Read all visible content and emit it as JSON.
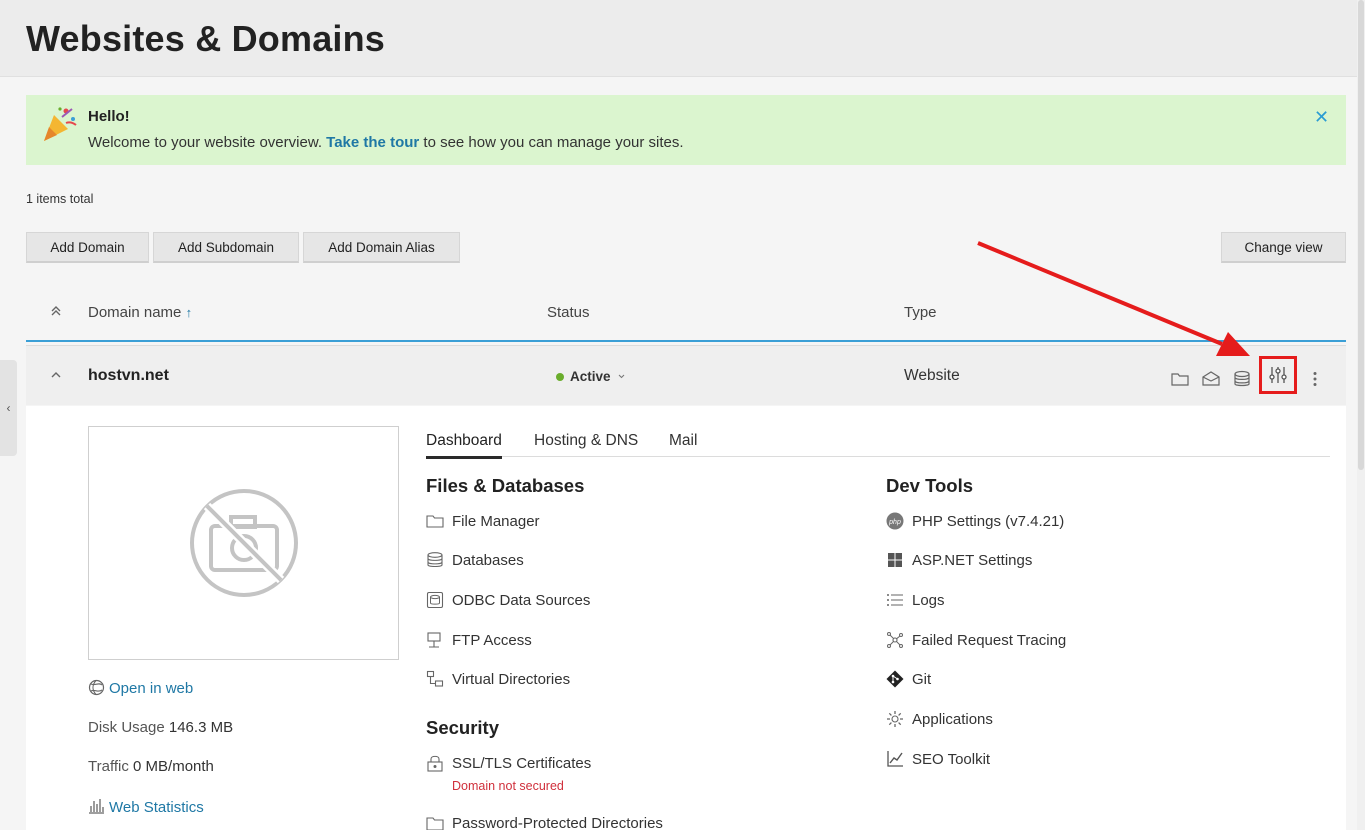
{
  "page": {
    "title": "Websites & Domains"
  },
  "banner": {
    "hello": "Hello!",
    "msg_before": "Welcome to your website overview. ",
    "tour_link": "Take the tour",
    "msg_after": " to see how you can manage your sites.",
    "close": "✕"
  },
  "list": {
    "total": "1 items total"
  },
  "toolbar": {
    "add_domain": "Add Domain",
    "add_subdomain": "Add Subdomain",
    "add_alias": "Add Domain Alias",
    "change_view": "Change view"
  },
  "table": {
    "col_domain": "Domain name",
    "sort_indicator": "↑",
    "col_status": "Status",
    "col_type": "Type"
  },
  "domain_row": {
    "name": "hostvn.net",
    "status": "Active",
    "type": "Website",
    "status_color": "#6aad2c"
  },
  "details": {
    "open_in_web": "Open in web",
    "disk_usage_label": "Disk Usage",
    "disk_usage_value": "146.3 MB",
    "traffic_label": "Traffic",
    "traffic_value": "0 MB/month",
    "web_statistics": "Web Statistics",
    "tabs": [
      "Dashboard",
      "Hosting & DNS",
      "Mail"
    ],
    "files_title": "Files & Databases",
    "files_items": [
      "File Manager",
      "Databases",
      "ODBC Data Sources",
      "FTP Access",
      "Virtual Directories"
    ],
    "security_title": "Security",
    "security_items": [
      "SSL/TLS Certificates",
      "Password-Protected Directories"
    ],
    "ssl_note": "Domain not secured",
    "dev_title": "Dev Tools",
    "dev_items": [
      "PHP Settings (v7.4.21)",
      "ASP.NET Settings",
      "Logs",
      "Failed Request Tracing",
      "Git",
      "Applications",
      "SEO Toolkit"
    ]
  },
  "colors": {
    "accent": "#1f78a5",
    "banner_bg": "#dbf5cf",
    "header_rule": "#3b9fd6",
    "annotation": "#e51c1c"
  }
}
